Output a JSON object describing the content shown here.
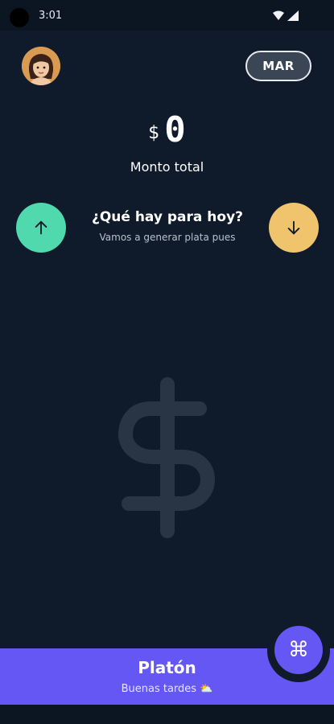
{
  "status_bar": {
    "time": "3:01"
  },
  "header": {
    "month_label": "MAR"
  },
  "balance": {
    "currency": "$",
    "amount": "0",
    "label": "Monto total"
  },
  "prompt": {
    "title": "¿Qué hay para hoy?",
    "subtitle": "Vamos a generar plata pues"
  },
  "footer": {
    "name": "Platón",
    "greeting": "Buenas tardes ⛅",
    "fab_icon": "⌘"
  },
  "colors": {
    "background": "#0f1a2a",
    "income": "#4fd9ad",
    "expense": "#efc46c",
    "accent": "#6457f3"
  },
  "icons": {
    "income": "arrow-up-icon",
    "expense": "arrow-down-icon",
    "watermark": "dollar-icon",
    "fab": "command-icon"
  }
}
